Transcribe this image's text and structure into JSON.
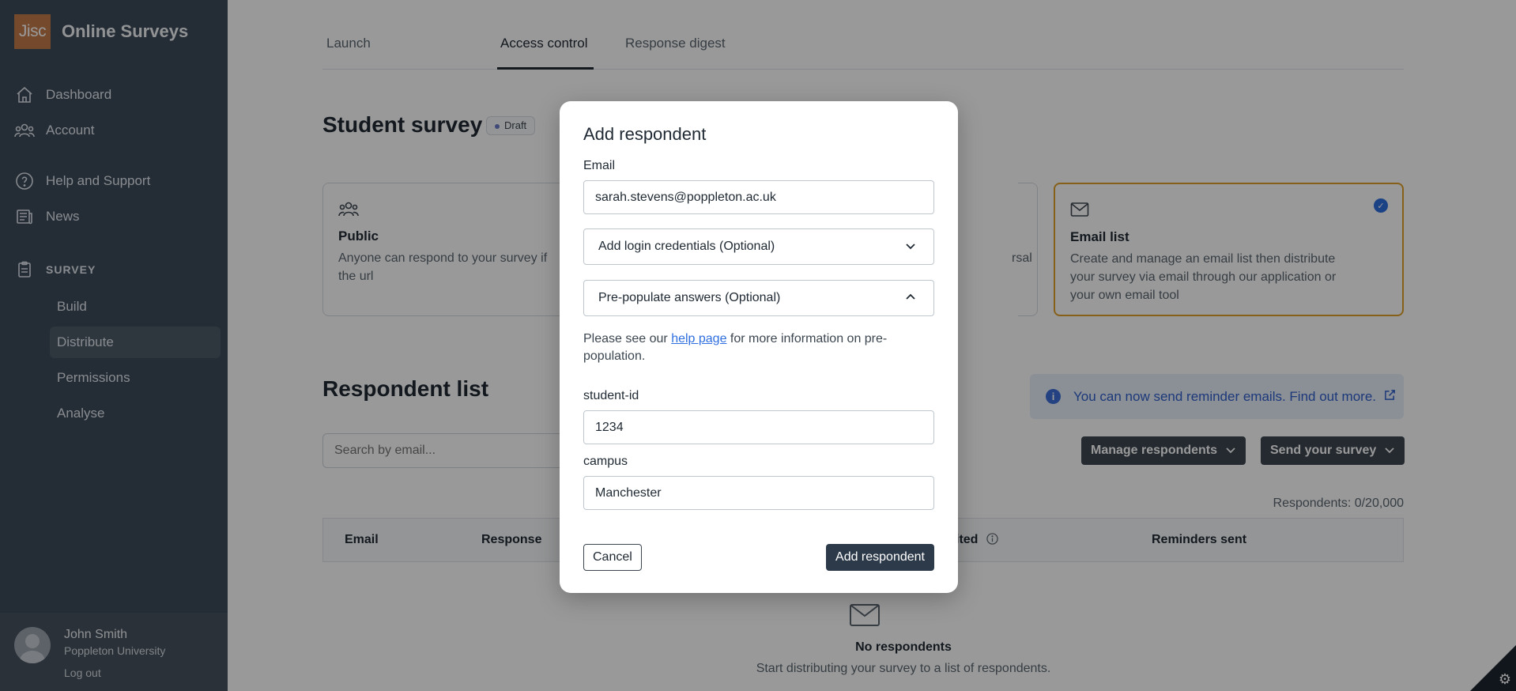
{
  "brand": {
    "logo_text": "Jisc",
    "name": "Online Surveys"
  },
  "sidebar": {
    "items": [
      {
        "label": "Dashboard",
        "icon": "home-icon"
      },
      {
        "label": "Account",
        "icon": "users-icon"
      },
      {
        "label": "Help and Support",
        "icon": "help-circle-icon"
      },
      {
        "label": "News",
        "icon": "newspaper-icon"
      }
    ],
    "section_label": "SURVEY",
    "sub_items": [
      "Build",
      "Distribute",
      "Permissions",
      "Analyse"
    ],
    "active_sub_item": "Distribute"
  },
  "user": {
    "name": "John Smith",
    "org": "Poppleton University",
    "logout": "Log out"
  },
  "tabs": [
    "Launch",
    "Access control",
    "Response digest"
  ],
  "active_tab": "Access control",
  "survey": {
    "title": "Student survey",
    "status": "Draft"
  },
  "cards": {
    "public": {
      "title": "Public",
      "desc_line1": "Anyone can respond to your survey if",
      "desc_line2": "the url"
    },
    "partial_right": {
      "desc_fragment": "rsal"
    },
    "email_list": {
      "title": "Email list",
      "desc_line1": "Create and manage an email list then distribute",
      "desc_line2": "your survey via email through our application or",
      "desc_line3": "your own email tool"
    }
  },
  "respondent_list": {
    "title": "Respondent list",
    "banner": "You can now send reminder emails. Find out more.",
    "search_placeholder": "Search by email...",
    "manage_button": "Manage respondents",
    "send_button": "Send your survey",
    "count": "Respondents: 0/20,000",
    "columns": [
      "Email",
      "Response",
      "ited",
      "Reminders sent"
    ],
    "empty_title": "No respondents",
    "empty_desc": "Start distributing your survey to a list of respondents."
  },
  "modal": {
    "title": "Add respondent",
    "email_label": "Email",
    "email_value": "sarah.stevens@poppleton.ac.uk",
    "login_accordion": "Add login credentials (Optional)",
    "prepopulate_accordion": "Pre-populate answers (Optional)",
    "help_prefix": "Please see our ",
    "help_link": "help page",
    "help_suffix": " for more information on pre-population.",
    "fields": [
      {
        "label": "student-id",
        "value": "1234"
      },
      {
        "label": "campus",
        "value": "Manchester"
      }
    ],
    "cancel": "Cancel",
    "submit": "Add respondent"
  },
  "colors": {
    "sidebar": "#3c4a5a",
    "accent_orange": "#c47a4a",
    "selected_border": "#e0a12a",
    "primary_dark": "#2d3a4a",
    "link": "#2f6fe0"
  }
}
